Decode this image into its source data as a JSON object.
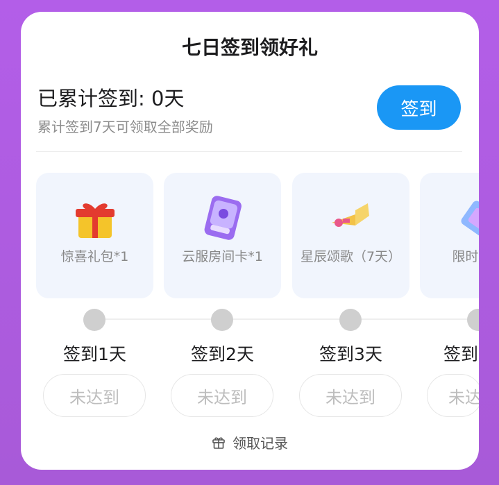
{
  "title": "七日签到领好礼",
  "summary": {
    "line": "已累计签到: 0天",
    "sub": "累计签到7天可领取全部奖励"
  },
  "checkin_button": "签到",
  "rewards": [
    {
      "name": "惊喜礼包*1",
      "icon": "gift-box-icon"
    },
    {
      "name": "云服房间卡*1",
      "icon": "mini-room-card-icon"
    },
    {
      "name": "星辰颂歌（7天）",
      "icon": "trumpet-icon"
    },
    {
      "name": "限时拾券",
      "icon": "coupon-icon"
    }
  ],
  "days": [
    {
      "label": "签到1天",
      "status": "未达到"
    },
    {
      "label": "签到2天",
      "status": "未达到"
    },
    {
      "label": "签到3天",
      "status": "未达到"
    },
    {
      "label": "签到",
      "status": "未达"
    }
  ],
  "record_link": "领取记录",
  "colors": {
    "background": "#b35ee8",
    "accent": "#1a97f5",
    "card_bg": "#f1f5fd"
  }
}
